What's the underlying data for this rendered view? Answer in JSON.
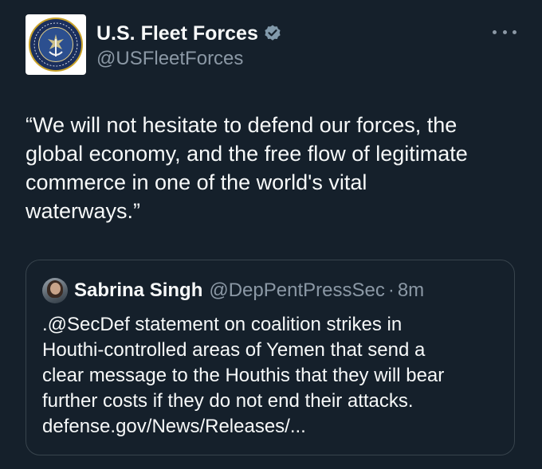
{
  "tweet": {
    "author": {
      "display_name": "U.S. Fleet Forces",
      "handle": "@USFleetForces",
      "verified": true,
      "avatar_icon": "us-fleet-forces-command-seal"
    },
    "text": "“We will not hesitate to defend our forces, the\nglobal economy, and the free flow of legitimate\ncommerce in one of the world's vital\nwaterways.”",
    "more_icon": "more-options-icon"
  },
  "quoted_tweet": {
    "author": {
      "display_name": "Sabrina Singh",
      "handle": "@DepPentPressSec",
      "avatar_icon": "profile-photo"
    },
    "separator": "·",
    "time": "8m",
    "text": ".@SecDef statement on coalition strikes in\nHouthi-controlled areas of Yemen that send a\nclear message to the Houthis that they will bear\nfurther costs if they do not end their attacks.\ndefense.gov/News/Releases/..."
  },
  "colors": {
    "background": "#15202b",
    "text_primary": "#f7f9f9",
    "text_secondary": "#8b98a5",
    "border": "#38444d",
    "verified_badge": "#829aab"
  }
}
